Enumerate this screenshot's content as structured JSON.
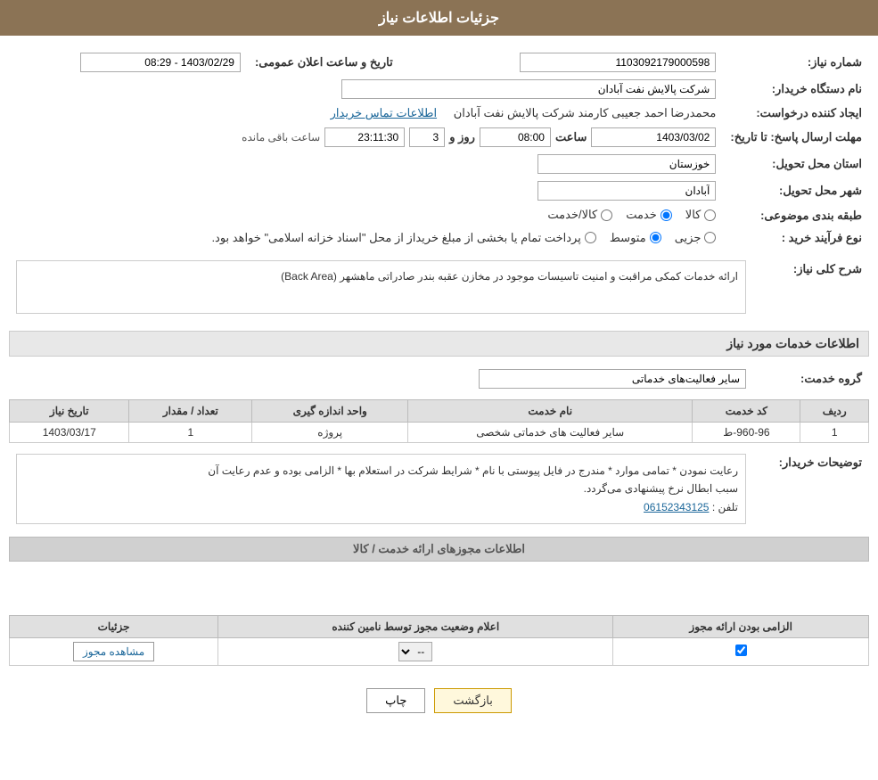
{
  "header": {
    "title": "جزئیات اطلاعات نیاز"
  },
  "fields": {
    "need_number_label": "شماره نیاز:",
    "need_number_value": "1103092179000598",
    "buyer_station_label": "نام دستگاه خریدار:",
    "buyer_station_value": "شرکت پالایش نفت آبادان",
    "creator_label": "ایجاد کننده درخواست:",
    "creator_value": "محمدرضا احمد جعیبی کارمند شرکت پالایش نفت آبادان",
    "creator_link": "اطلاعات تماس خریدار",
    "announce_label": "تاریخ و ساعت اعلان عمومی:",
    "announce_value": "1403/02/29 - 08:29",
    "deadline_label": "مهلت ارسال پاسخ: تا تاریخ:",
    "deadline_date": "1403/03/02",
    "deadline_time_label": "ساعت",
    "deadline_time": "08:00",
    "deadline_days_label": "روز و",
    "deadline_days": "3",
    "deadline_remaining_label": "ساعت باقی مانده",
    "deadline_remaining": "23:11:30",
    "province_label": "استان محل تحویل:",
    "province_value": "خوزستان",
    "city_label": "شهر محل تحویل:",
    "city_value": "آبادان",
    "category_label": "طبقه بندی موضوعی:",
    "category_options": [
      "کالا",
      "خدمت",
      "کالا/خدمت"
    ],
    "category_selected": "خدمت",
    "purchase_type_label": "نوع فرآیند خرید :",
    "purchase_type_options": [
      "جزیی",
      "متوسط",
      "پرداخت تمام یا بخشی از مبلغ خریدار از محل \"اسناد خزانه اسلامی\" خواهد بود."
    ],
    "purchase_type_selected": "متوسط",
    "need_desc_label": "شرح کلی نیاز:",
    "need_desc_value": "ارائه خدمات کمکی مراقبت و امنیت تاسیسات موجود در مخازن عقبه بندر صادراتی ماهشهر (Back Area)",
    "service_info_title": "اطلاعات خدمات مورد نیاز",
    "service_group_label": "گروه خدمت:",
    "service_group_value": "سایر فعالیت‌های خدماتی"
  },
  "table": {
    "headers": [
      "ردیف",
      "کد خدمت",
      "نام خدمت",
      "واحد اندازه گیری",
      "تعداد / مقدار",
      "تاریخ نیاز"
    ],
    "rows": [
      {
        "row": "1",
        "code": "960-96-ط",
        "name": "سایر فعالیت های خدماتی شخصی",
        "unit": "پروژه",
        "quantity": "1",
        "date": "1403/03/17"
      }
    ]
  },
  "buyer_notes": {
    "label": "توضیحات خریدار:",
    "text1": "رعایت نمودن * تمامی موارد * مندرج در فایل پیوستی با نام * شرایط شرکت در استعلام بها * الزامی بوده و عدم رعایت آن",
    "text2": "سبب ابطال نرخ پیشنهادی می‌گردد.",
    "phone_label": "تلفن :",
    "phone": "06152343125"
  },
  "permit_section": {
    "title": "اطلاعات مجوزهای ارائه خدمت / کالا",
    "table_headers": [
      "الزامی بودن ارائه مجوز",
      "اعلام وضعیت مجوز توسط نامین کننده",
      "جزئیات"
    ],
    "rows": [
      {
        "required": true,
        "status": "--",
        "details_btn": "مشاهده مجوز"
      }
    ]
  },
  "buttons": {
    "back": "بازگشت",
    "print": "چاپ"
  }
}
